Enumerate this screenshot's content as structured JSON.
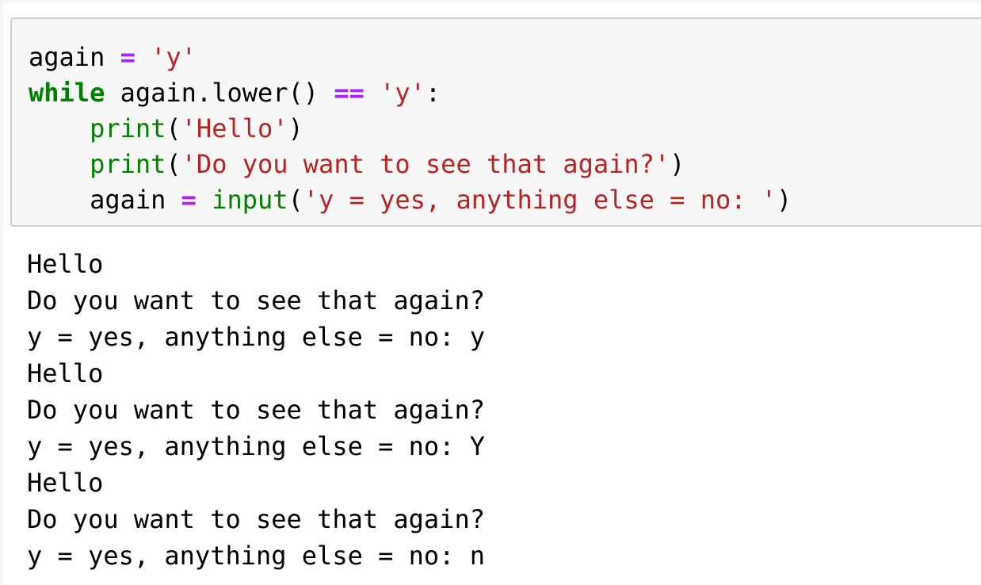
{
  "colors": {
    "keyword": "#008000",
    "builtin": "#008000",
    "operator": "#aa22ff",
    "string": "#ba2121",
    "text": "#000000",
    "cell_background": "#f7f7f7",
    "cell_border": "#cfcfcf"
  },
  "code_cell": {
    "lines": [
      [
        {
          "type": "name",
          "text": "again"
        },
        {
          "type": "punct",
          "text": " "
        },
        {
          "type": "op",
          "text": "="
        },
        {
          "type": "punct",
          "text": " "
        },
        {
          "type": "str",
          "text": "'y'"
        }
      ],
      [
        {
          "type": "kw",
          "text": "while"
        },
        {
          "type": "punct",
          "text": " "
        },
        {
          "type": "name",
          "text": "again"
        },
        {
          "type": "punct",
          "text": ".lower() "
        },
        {
          "type": "op",
          "text": "=="
        },
        {
          "type": "punct",
          "text": " "
        },
        {
          "type": "str",
          "text": "'y'"
        },
        {
          "type": "punct",
          "text": ":"
        }
      ],
      [
        {
          "type": "punct",
          "text": "    "
        },
        {
          "type": "builtin",
          "text": "print"
        },
        {
          "type": "punct",
          "text": "("
        },
        {
          "type": "str",
          "text": "'Hello'"
        },
        {
          "type": "punct",
          "text": ")"
        }
      ],
      [
        {
          "type": "punct",
          "text": "    "
        },
        {
          "type": "builtin",
          "text": "print"
        },
        {
          "type": "punct",
          "text": "("
        },
        {
          "type": "str",
          "text": "'Do you want to see that again?'"
        },
        {
          "type": "punct",
          "text": ")"
        }
      ],
      [
        {
          "type": "punct",
          "text": "    "
        },
        {
          "type": "name",
          "text": "again"
        },
        {
          "type": "punct",
          "text": " "
        },
        {
          "type": "op",
          "text": "="
        },
        {
          "type": "punct",
          "text": " "
        },
        {
          "type": "builtin",
          "text": "input"
        },
        {
          "type": "punct",
          "text": "("
        },
        {
          "type": "str",
          "text": "'y = yes, anything else = no: '"
        },
        {
          "type": "punct",
          "text": ")"
        }
      ]
    ]
  },
  "output_cell": {
    "lines": [
      "Hello",
      "Do you want to see that again?",
      "y = yes, anything else = no: y",
      "Hello",
      "Do you want to see that again?",
      "y = yes, anything else = no: Y",
      "Hello",
      "Do you want to see that again?",
      "y = yes, anything else = no: n"
    ]
  }
}
